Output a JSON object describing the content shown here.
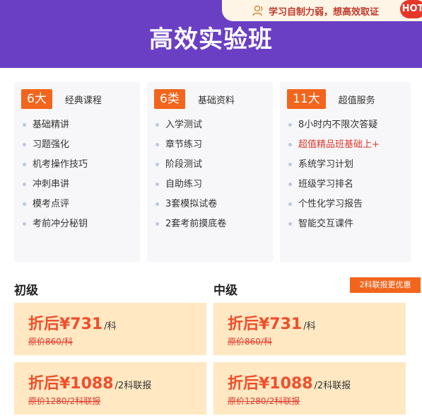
{
  "header": {
    "tag_text": "学习自制力弱，想高效取证",
    "hot_label": "HOT",
    "title": "高效实验班"
  },
  "columns": [
    {
      "badge": "6大",
      "subtitle": "经典课程",
      "items": [
        "基础精讲",
        "习题强化",
        "机考操作技巧",
        "冲刺串讲",
        "模考点评",
        "考前冲分秘钥"
      ]
    },
    {
      "badge": "6类",
      "subtitle": "基础资料",
      "items": [
        "入学测试",
        "章节练习",
        "阶段测试",
        "自助练习",
        "3套模拟试卷",
        "2套考前摸底卷"
      ]
    },
    {
      "badge": "11大",
      "subtitle": "超值服务",
      "items": [
        "8小时内不限次答疑",
        "超值精品班基础上+",
        "系统学习计划",
        "班级学习排名",
        "个性化学习报告",
        "智能交互课件"
      ]
    }
  ],
  "pricing": {
    "tier1": "初级",
    "tier2": "中级",
    "combo_badge": "2科联报更优惠",
    "cards": [
      {
        "now": "折后¥731",
        "unit": "/科",
        "orig": "原价860/科"
      },
      {
        "now": "折后¥731",
        "unit": "/科",
        "orig": "原价860/科"
      },
      {
        "now": "折后¥1088",
        "unit": "/2科联报",
        "orig": "原价1280/2科联报"
      },
      {
        "now": "折后¥1088",
        "unit": "/2科联报",
        "orig": "原价1280/2科联报"
      }
    ]
  },
  "colors": {
    "header": "#6a3fc4",
    "accent": "#f2651d",
    "card": "#ffe8c2",
    "highlight": "#e03a2f"
  },
  "icons": {
    "tag": "user-icon"
  }
}
